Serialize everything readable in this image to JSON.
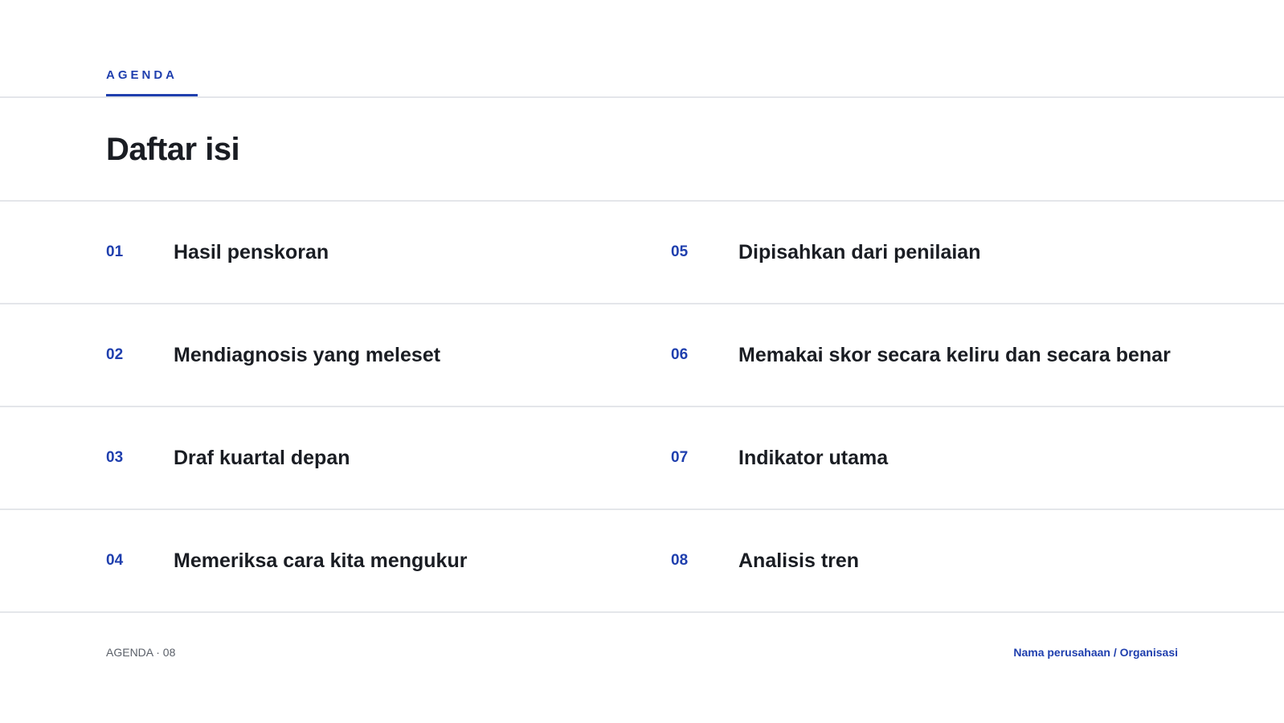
{
  "header": {
    "section_label": "AGENDA",
    "title": "Daftar isi"
  },
  "agenda": {
    "items": [
      {
        "num": "01",
        "title": "Hasil penskoran"
      },
      {
        "num": "02",
        "title": "Mendiagnosis yang meleset"
      },
      {
        "num": "03",
        "title": "Draf kuartal depan"
      },
      {
        "num": "04",
        "title": "Memeriksa cara kita mengukur"
      },
      {
        "num": "05",
        "title": "Dipisahkan dari penilaian"
      },
      {
        "num": "06",
        "title": "Memakai skor secara keliru dan secara benar"
      },
      {
        "num": "07",
        "title": "Indikator utama"
      },
      {
        "num": "08",
        "title": "Analisis tren"
      }
    ]
  },
  "footer": {
    "left": "AGENDA · 08",
    "right": "Nama perusahaan / Organisasi"
  },
  "colors": {
    "accent": "#1f3fae",
    "text": "#1a1d23",
    "divider": "#e4e6ea"
  }
}
